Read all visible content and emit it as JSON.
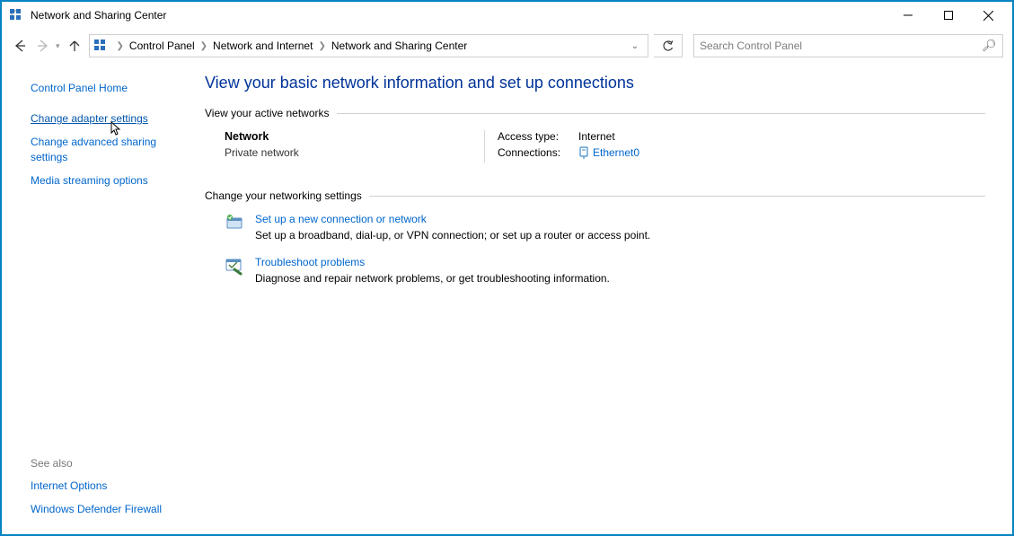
{
  "window": {
    "title": "Network and Sharing Center"
  },
  "breadcrumbs": {
    "b0": "Control Panel",
    "b1": "Network and Internet",
    "b2": "Network and Sharing Center"
  },
  "search": {
    "placeholder": "Search Control Panel"
  },
  "sidebar": {
    "home": "Control Panel Home",
    "l0": "Change adapter settings",
    "l1": "Change advanced sharing settings",
    "l2": "Media streaming options",
    "seealso_label": "See also",
    "sa0": "Internet Options",
    "sa1": "Windows Defender Firewall"
  },
  "main": {
    "heading": "View your basic network information and set up connections",
    "active_section": "View your active networks",
    "network": {
      "name": "Network",
      "type": "Private network",
      "access_label": "Access type:",
      "access_value": "Internet",
      "conn_label": "Connections:",
      "conn_value": "Ethernet0"
    },
    "change_section": "Change your networking settings",
    "task0": {
      "link": "Set up a new connection or network",
      "desc": "Set up a broadband, dial-up, or VPN connection; or set up a router or access point."
    },
    "task1": {
      "link": "Troubleshoot problems",
      "desc": "Diagnose and repair network problems, or get troubleshooting information."
    }
  }
}
